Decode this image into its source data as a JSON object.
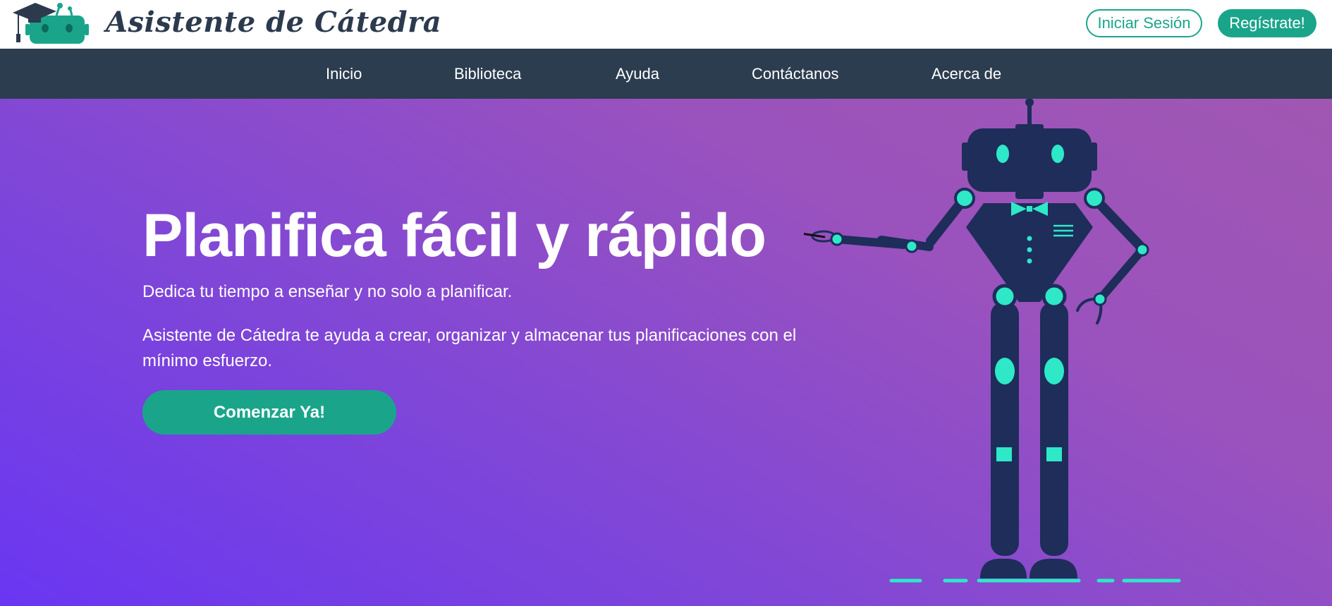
{
  "header": {
    "brand_title": "Asistente de Cátedra",
    "login_label": "Iniciar Sesión",
    "register_label": "Regístrate!"
  },
  "nav": {
    "items": [
      "Inicio",
      "Biblioteca",
      "Ayuda",
      "Contáctanos",
      "Acerca de"
    ]
  },
  "hero": {
    "title": "Planifica fácil y rápido",
    "subtitle": "Dedica tu tiempo a enseñar y no solo a planificar.",
    "description": "Asistente de Cátedra te ayuda a crear, organizar y almacenar tus planificaciones con el mínimo esfuerzo.",
    "cta_label": "Comenzar Ya!"
  },
  "colors": {
    "accent": "#1aa58b",
    "nav_bg": "#2c3d50",
    "robot_body": "#1e2d5a",
    "robot_joint": "#2ee8c8"
  },
  "icons": {
    "logo": "graduation-cap-robot-logo"
  }
}
